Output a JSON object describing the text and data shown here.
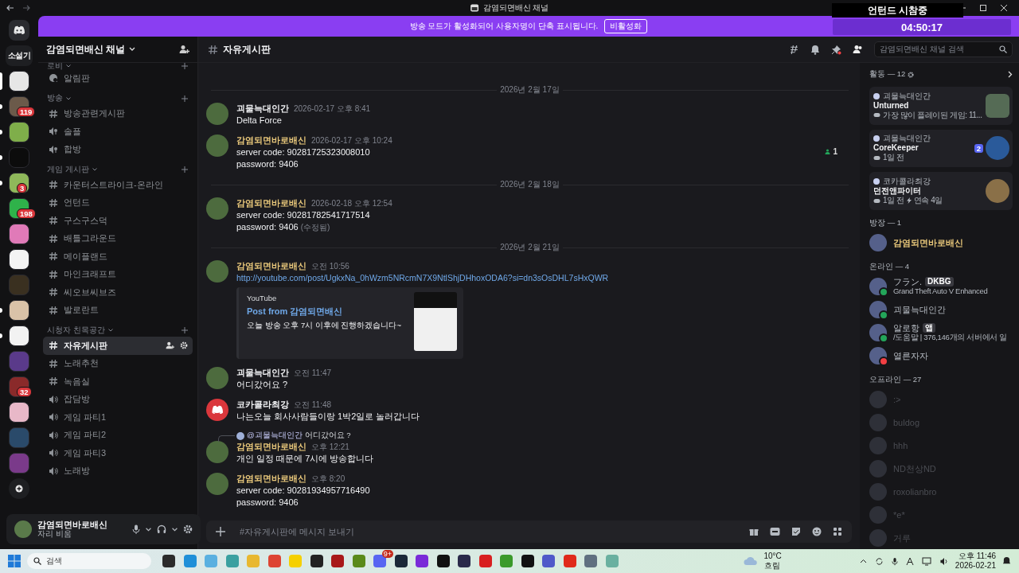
{
  "window": {
    "title": "감염되면배신 채널"
  },
  "overlay": {
    "caption": "언턴드 시참중",
    "timer": "04:50:17"
  },
  "banner": {
    "text": "방송 모드가 활성화되어 사용자명이 단축 표시됩니다.",
    "button": "비활성화"
  },
  "servers": [
    {
      "kind": "text",
      "label": "소설기",
      "selected": false,
      "unread": false
    },
    {
      "kind": "picture",
      "color": "#e6e6e6",
      "selected": true,
      "unread": false
    },
    {
      "kind": "picture",
      "color": "#6b5a4a",
      "selected": false,
      "unread": true,
      "badge": "119"
    },
    {
      "kind": "picture",
      "color": "#7fae4a",
      "selected": false,
      "unread": true
    },
    {
      "kind": "picture",
      "color": "#0c0c0c",
      "selected": false,
      "unread": true
    },
    {
      "kind": "picture",
      "color": "#8fb85a",
      "selected": false,
      "unread": true,
      "badge": "3"
    },
    {
      "kind": "picture",
      "color": "#2fb24a",
      "selected": false,
      "unread": false,
      "badge": "198"
    },
    {
      "kind": "picture",
      "color": "#e07ab8",
      "selected": false,
      "unread": false
    },
    {
      "kind": "picture",
      "color": "#f4f4f4",
      "selected": false,
      "unread": false
    },
    {
      "kind": "picture",
      "color": "#3a3020",
      "selected": false,
      "unread": false
    },
    {
      "kind": "picture",
      "color": "#d9c2a8",
      "selected": false,
      "unread": true
    },
    {
      "kind": "picture",
      "color": "#f2f2f2",
      "selected": false,
      "unread": true
    },
    {
      "kind": "picture",
      "color": "#5a3a8a",
      "selected": false,
      "unread": false
    },
    {
      "kind": "picture",
      "color": "#8a2a2a",
      "selected": false,
      "unread": false,
      "badge": "32"
    },
    {
      "kind": "picture",
      "color": "#e8b8c8",
      "selected": false,
      "unread": false
    },
    {
      "kind": "picture",
      "color": "#2a4a6a",
      "selected": false,
      "unread": false
    },
    {
      "kind": "picture",
      "color": "#7a3a8a",
      "selected": false,
      "unread": false
    }
  ],
  "sidebar": {
    "server_name": "감염되면배신 채널",
    "categories": [
      {
        "name": "로비",
        "channels": [
          {
            "kind": "forum",
            "name": "알림판",
            "selected": false
          }
        ]
      },
      {
        "name": "방송",
        "channels": [
          {
            "kind": "text",
            "name": "방송관련게시판",
            "selected": false
          },
          {
            "kind": "stage",
            "name": "솔플",
            "selected": false
          },
          {
            "kind": "stage",
            "name": "합방",
            "selected": false
          }
        ]
      },
      {
        "name": "게임 게시판",
        "channels": [
          {
            "kind": "text",
            "name": "카운터스트라이크-온라인",
            "selected": false
          },
          {
            "kind": "text",
            "name": "언턴드",
            "selected": false
          },
          {
            "kind": "text",
            "name": "구스구스덕",
            "selected": false
          },
          {
            "kind": "text",
            "name": "배틀그라운드",
            "selected": false
          },
          {
            "kind": "text",
            "name": "메이플랜드",
            "selected": false
          },
          {
            "kind": "text",
            "name": "마인크래프트",
            "selected": false
          },
          {
            "kind": "text",
            "name": "씨오브씨브즈",
            "selected": false
          },
          {
            "kind": "text",
            "name": "발로란트",
            "selected": false
          }
        ]
      },
      {
        "name": "시청자 친목공간",
        "channels": [
          {
            "kind": "text",
            "name": "자유게시판",
            "selected": true
          },
          {
            "kind": "text",
            "name": "노래추천",
            "selected": false
          },
          {
            "kind": "text",
            "name": "녹음실",
            "selected": false
          },
          {
            "kind": "voice",
            "name": "잡담방",
            "selected": false
          },
          {
            "kind": "voice",
            "name": "게임 파티1",
            "selected": false
          },
          {
            "kind": "voice",
            "name": "게임 파티2",
            "selected": false
          },
          {
            "kind": "voice",
            "name": "게임 파티3",
            "selected": false
          },
          {
            "kind": "voice",
            "name": "노래방",
            "selected": false
          }
        ]
      }
    ]
  },
  "user_panel": {
    "name": "감염되면바로배신",
    "status": "자리 비움"
  },
  "channel_header": {
    "name": "자유게시판"
  },
  "search": {
    "placeholder": "감염되면배신 채널 검색"
  },
  "floating_count": "1",
  "messages": [
    {
      "kind": "divider",
      "date": "2026년 2월 17일"
    },
    {
      "kind": "message",
      "author": "괴물늑대인간",
      "color": "#f2f3f5",
      "time": "2026-02-17 오후 8:41",
      "default_avatar": false,
      "lines": [
        "Delta Force"
      ]
    },
    {
      "kind": "message",
      "author": "감염되면바로배신",
      "color": "#e8c77a",
      "time": "2026-02-17 오후 10:24",
      "default_avatar": false,
      "lines": [
        "server code: 90281725323008010",
        "password: 9406"
      ]
    },
    {
      "kind": "divider",
      "date": "2026년 2월 18일"
    },
    {
      "kind": "message",
      "author": "감염되면바로배신",
      "color": "#e8c77a",
      "time": "2026-02-18 오후 12:54",
      "default_avatar": false,
      "lines": [
        "server code: 90281782541717514",
        "password: 9406"
      ],
      "edited": "(수정됨)"
    },
    {
      "kind": "divider",
      "date": "2026년 2월 21일"
    },
    {
      "kind": "message",
      "author": "감염되면바로배신",
      "color": "#e8c77a",
      "time": "오전 10:56",
      "default_avatar": false,
      "link": "http://youtube.com/post/UgkxNa_0hWzm5NRcmN7X9NtlShjDHhoxODA6?si=dn3sOsDHL7sHxQWR",
      "embed": {
        "provider": "YouTube",
        "title": "Post from 감염되면배신",
        "description": "오늘 방송 오후 7시 이후에 진행하겠습니다~"
      }
    },
    {
      "kind": "message",
      "author": "괴물늑대인간",
      "color": "#f2f3f5",
      "time": "오전 11:47",
      "default_avatar": false,
      "lines": [
        "어디갔어요 ?"
      ]
    },
    {
      "kind": "message",
      "author": "코카콜라최강",
      "color": "#f2f3f5",
      "time": "오전 11:48",
      "default_avatar": true,
      "lines": [
        "나는오늘 회사사람들이랑 1박2일로 놀러갑니다"
      ]
    },
    {
      "kind": "message",
      "author": "감염되면바로배신",
      "color": "#e8c77a",
      "time": "오후 12:21",
      "default_avatar": false,
      "reply": {
        "mention": "@괴물늑대인간",
        "text": "어디갔어요 ?"
      },
      "lines": [
        "개인 일정 때문에 7시에 방송합니다"
      ]
    },
    {
      "kind": "message",
      "author": "감염되면바로배신",
      "color": "#e8c77a",
      "time": "오후 8:20",
      "default_avatar": false,
      "lines": [
        "server code: 90281934957716490",
        "password: 9406"
      ]
    }
  ],
  "composer": {
    "placeholder": "#자유게시판에 메시지 보내기"
  },
  "members": {
    "activity_title": "활동 — 12",
    "cards": [
      {
        "user": "괴물늑대인간",
        "title": "Unturned",
        "detail": "가장 많이 플레이된 게임: 11..."
      },
      {
        "user": "괴물늑대인간",
        "title": "CoreKeeper",
        "detail": "1일 전",
        "count": "2"
      },
      {
        "user": "코카콜라최강",
        "title": "던전앤파이터",
        "detail": "1일 전",
        "streak": "연속 4일"
      }
    ],
    "groups": [
      {
        "title": "방장 — 1",
        "members": [
          {
            "name": "감염되면바로배신",
            "kind": "owner"
          }
        ]
      },
      {
        "title": "온라인 — 4",
        "members": [
          {
            "name": "フラン.",
            "kind": "online",
            "tag": "DKBG",
            "activity": "Grand Theft Auto V Enhanced"
          },
          {
            "name": "괴물늑대인간",
            "kind": "online"
          },
          {
            "name": "알로항",
            "kind": "mobile",
            "tag": "앱",
            "activity": "/도움말 | 376,146개의 서버에서 일"
          },
          {
            "name": "열른자자",
            "kind": "dnd"
          }
        ]
      },
      {
        "title": "오프라인 — 27",
        "members": [
          {
            "name": ":>",
            "kind": "offline"
          },
          {
            "name": "buldog",
            "kind": "offline"
          },
          {
            "name": "hhh",
            "kind": "offline"
          },
          {
            "name": "ND천상ND",
            "kind": "offline"
          },
          {
            "name": "roxolianbro",
            "kind": "offline"
          },
          {
            "name": "*e*",
            "kind": "offline"
          },
          {
            "name": "거루",
            "kind": "offline"
          }
        ]
      }
    ]
  },
  "taskbar": {
    "search": "검색",
    "apps": [
      {
        "color": "#2b2b2b"
      },
      {
        "color": "#1f8fd8"
      },
      {
        "color": "#5ab0e0"
      },
      {
        "color": "#3aa0a0"
      },
      {
        "color": "#e8b830"
      },
      {
        "color": "#dd4433"
      },
      {
        "color": "#f5d000"
      },
      {
        "color": "#222222"
      },
      {
        "color": "#a81818"
      },
      {
        "color": "#5a8a1a"
      },
      {
        "color": "#5865f2",
        "badge": "9+"
      },
      {
        "color": "#1b2838"
      },
      {
        "color": "#7a2ad8"
      },
      {
        "color": "#111111"
      },
      {
        "color": "#2a2a4a"
      },
      {
        "color": "#d82020"
      },
      {
        "color": "#3a9a2a"
      },
      {
        "color": "#111111"
      },
      {
        "color": "#5059c9"
      },
      {
        "color": "#e02a1a"
      },
      {
        "color": "#607080"
      },
      {
        "color": "#6ab0a0"
      }
    ],
    "weather_temp": "10°C",
    "weather_text": "흐림",
    "time": "오후 11:46",
    "date": "2026-02-21"
  }
}
